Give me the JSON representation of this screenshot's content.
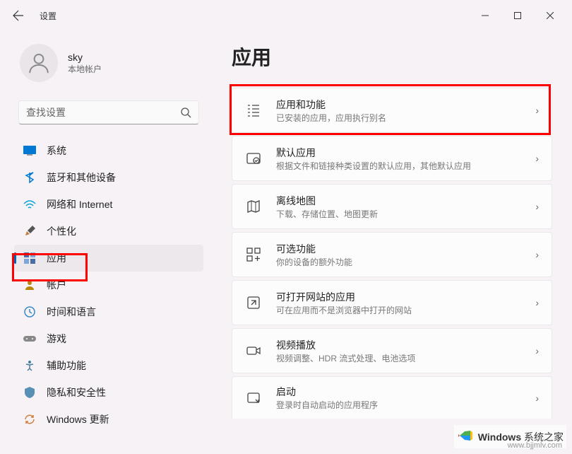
{
  "titlebar": {
    "title": "设置"
  },
  "user": {
    "name": "sky",
    "subtitle": "本地帐户"
  },
  "search": {
    "placeholder": "查找设置"
  },
  "nav": {
    "items": [
      {
        "label": "系统",
        "icon": "system"
      },
      {
        "label": "蓝牙和其他设备",
        "icon": "bluetooth"
      },
      {
        "label": "网络和 Internet",
        "icon": "network"
      },
      {
        "label": "个性化",
        "icon": "personalize"
      },
      {
        "label": "应用",
        "icon": "apps"
      },
      {
        "label": "帐户",
        "icon": "accounts"
      },
      {
        "label": "时间和语言",
        "icon": "time"
      },
      {
        "label": "游戏",
        "icon": "gaming"
      },
      {
        "label": "辅助功能",
        "icon": "accessibility"
      },
      {
        "label": "隐私和安全性",
        "icon": "privacy"
      },
      {
        "label": "Windows 更新",
        "icon": "update"
      }
    ]
  },
  "page": {
    "title": "应用"
  },
  "cards": [
    {
      "title": "应用和功能",
      "subtitle": "已安装的应用，应用执行别名"
    },
    {
      "title": "默认应用",
      "subtitle": "根据文件和链接种类设置的默认应用，其他默认应用"
    },
    {
      "title": "离线地图",
      "subtitle": "下载、存储位置、地图更新"
    },
    {
      "title": "可选功能",
      "subtitle": "你的设备的额外功能"
    },
    {
      "title": "可打开网站的应用",
      "subtitle": "可在应用而不是浏览器中打开的网站"
    },
    {
      "title": "视频播放",
      "subtitle": "视频调整、HDR 流式处理、电池选项"
    },
    {
      "title": "启动",
      "subtitle": "登录时自动启动的应用程序"
    }
  ],
  "watermark": {
    "brand": "Windows",
    "suffix": "系统之家",
    "url": "www.bjjmlv.com"
  }
}
